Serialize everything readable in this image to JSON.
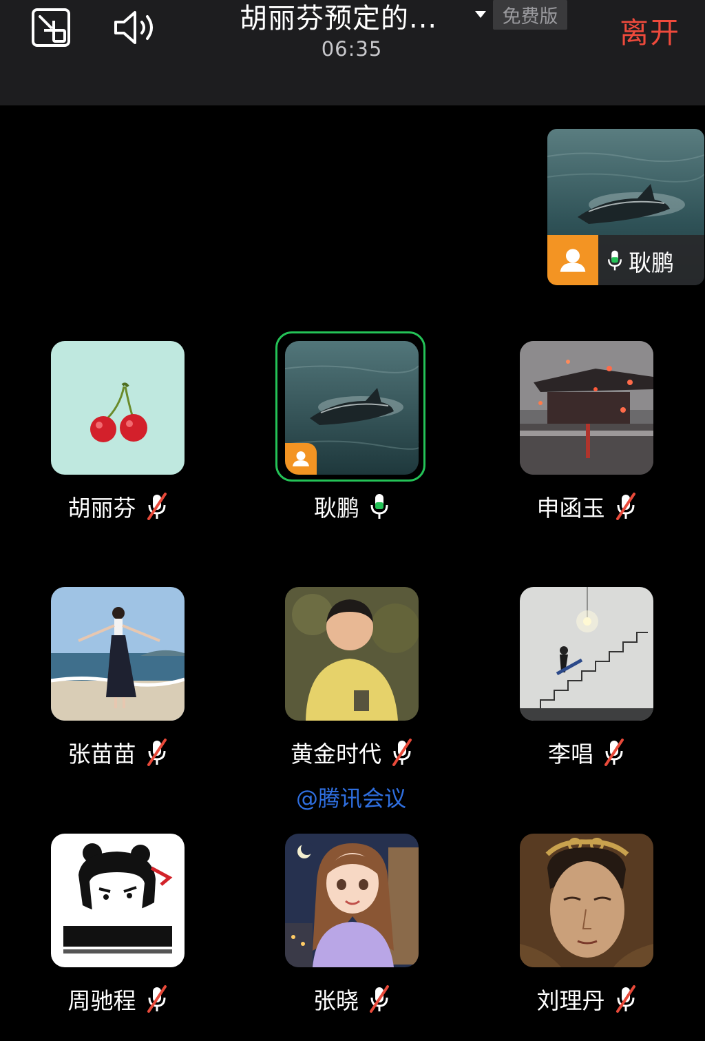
{
  "header": {
    "meeting_title": "胡丽芬预定的...",
    "plan_label": "免费版",
    "timer": "06:35",
    "leave_label": "离开"
  },
  "floating_video": {
    "name": "耿鹏"
  },
  "participants": [
    {
      "name": "胡丽芬",
      "mic": "muted"
    },
    {
      "name": "耿鹏",
      "mic": "on",
      "speaking": true
    },
    {
      "name": "申函玉",
      "mic": "muted"
    },
    {
      "name": "张苗苗",
      "mic": "muted"
    },
    {
      "name": "黄金时代",
      "mic": "muted"
    },
    {
      "name": "李唱",
      "mic": "muted"
    },
    {
      "name": "周驰程",
      "mic": "muted"
    },
    {
      "name": "张晓",
      "mic": "muted"
    },
    {
      "name": "刘理丹",
      "mic": "muted"
    }
  ],
  "mention": "@腾讯会议",
  "colors": {
    "accent_leave": "#ef4a3c",
    "active_speaker_border": "#24c257",
    "host_badge": "#f39423",
    "mention_link": "#2f6fe0",
    "mic_on": "#24c257",
    "mic_off_slash": "#e84a3a"
  },
  "icons": [
    "pip-icon",
    "speaker-icon",
    "caret-down-icon",
    "mic-on-icon",
    "mic-muted-icon",
    "host-badge-icon"
  ]
}
